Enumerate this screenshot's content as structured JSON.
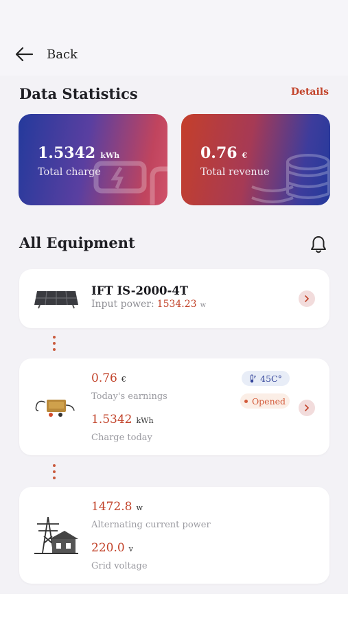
{
  "nav": {
    "back_label": "Back"
  },
  "statistics": {
    "title": "Data Statistics",
    "details_label": "Details",
    "cards": [
      {
        "value": "1.5342",
        "unit": "kWh",
        "label": "Total charge"
      },
      {
        "value": "0.76",
        "unit": "€",
        "label": "Total revenue"
      }
    ]
  },
  "equipment": {
    "title": "All Equipment",
    "panel": {
      "name": "IFT IS-2000-4T",
      "input_label": "Input power:",
      "input_value": "1534.23",
      "input_unit": "w"
    },
    "inverter": {
      "earnings_value": "0.76",
      "earnings_unit": "€",
      "earnings_label": "Today's earnings",
      "charge_value": "1.5342",
      "charge_unit": "kWh",
      "charge_label": "Charge today",
      "temperature": "45C°",
      "status": "Opened"
    },
    "grid": {
      "ac_power_value": "1472.8",
      "ac_power_unit": "w",
      "ac_power_label": "Alternating current power",
      "voltage_value": "220.0",
      "voltage_unit": "v",
      "voltage_label": "Grid voltage"
    }
  },
  "colors": {
    "accent": "#c2432a",
    "charge_card_start": "#243a9c",
    "charge_card_end": "#d0526a",
    "revenue_card_start": "#c43f2b",
    "revenue_card_end": "#243a9c"
  },
  "icons": [
    "arrow-left-icon",
    "bell-icon",
    "solar-panel-icon",
    "microinverter-icon",
    "power-grid-house-icon",
    "thermometer-icon",
    "chevron-right-icon"
  ]
}
